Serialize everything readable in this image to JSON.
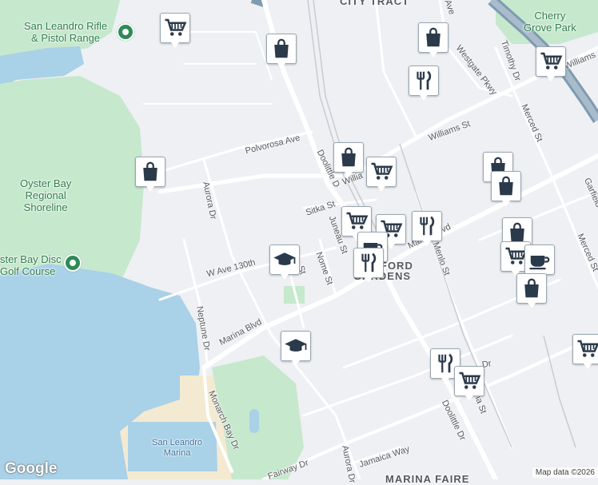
{
  "map": {
    "labels": {
      "rifle_range": "San Leandro Rifle\n& Pistol Range",
      "oyster_bay": "Oyster Bay\nRegional\nShoreline",
      "disc_golf": "ster Bay Disc\nGolf Course",
      "cherry_grove": "Cherry\nGrove Park",
      "san_leandro_marina": "San Leandro\nMarina",
      "washington_manor_partial": "CITY TRACT",
      "gardens_partial": "GARDENS",
      "ford_partial": "FORD",
      "marina_faire_partial": "MARINA FAIRE"
    },
    "streets": {
      "polvorosa": "Polvorosa Ave",
      "williams_mid": "Williams St",
      "williams_left": "Willia",
      "williams_right": "Williams",
      "doolittle_top": "Doolittle D",
      "doolittle_bottom": "Doolittle Dr",
      "aurora_top": "Aurora Dr",
      "aurora_bottom": "Aurora Dr",
      "sitka": "Sitka St",
      "juneau": "Juneau St",
      "nome": "Nome St",
      "st_short": "St",
      "w_ave_130": "W Ave 130th",
      "neptune": "Neptune Dr",
      "marina_blvd_left": "Marina Blvd",
      "marina_blvd_right": "Marina Blvd",
      "monarch_bay": "Monarch Bay Dr",
      "fairway": "Fairway Dr",
      "jamaica": "Jamaica Way",
      "menlo": "Menlo St",
      "merced_top": "Merced St",
      "merced_bottom": "Merced St",
      "westgate": "Westgate Pkwy",
      "timothy": "Timothy Dr",
      "garfield": "Garfield",
      "ave_top": "Ave",
      "alvarado_partial": "Dr",
      "lina": "ina St"
    },
    "pins": [
      {
        "type": "cart-icon"
      },
      {
        "type": "bag-icon"
      },
      {
        "type": "bag-icon"
      },
      {
        "type": "cart-icon"
      },
      {
        "type": "fork-knife-icon"
      },
      {
        "type": "bag-icon"
      },
      {
        "type": "bag-icon"
      },
      {
        "type": "cart-icon"
      },
      {
        "type": "bag-icon"
      },
      {
        "type": "bag-icon"
      },
      {
        "type": "cart-icon"
      },
      {
        "type": "cart-icon"
      },
      {
        "type": "fork-knife-icon"
      },
      {
        "type": "coffee-icon"
      },
      {
        "type": "fork-knife-icon"
      },
      {
        "type": "school-icon"
      },
      {
        "type": "bag-icon"
      },
      {
        "type": "cart-icon"
      },
      {
        "type": "coffee-icon"
      },
      {
        "type": "bag-icon"
      },
      {
        "type": "school-icon"
      },
      {
        "type": "fork-knife-icon"
      },
      {
        "type": "cart-icon"
      },
      {
        "type": "cart-icon"
      }
    ],
    "colors": {
      "water": "#a9d1e8",
      "park": "#c6e8cd",
      "land": "#eef0f3",
      "road": "#ffffff",
      "highway": "#7f9bb0",
      "pin_icon": "#2b3a4a",
      "sand": "#f3ead1"
    }
  },
  "footer": {
    "logo": "Google",
    "attribution": "Map data ©2026"
  }
}
